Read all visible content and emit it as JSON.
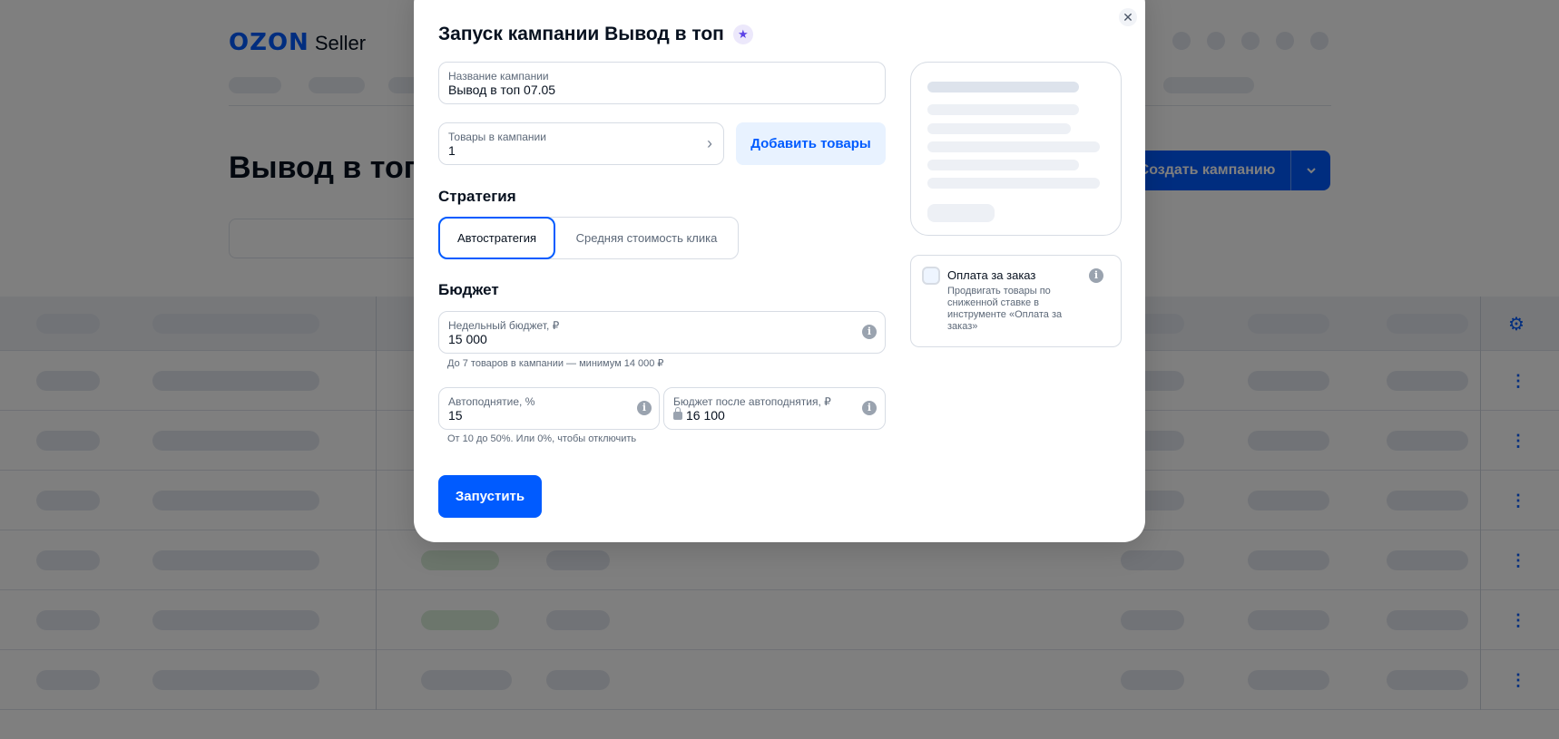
{
  "background": {
    "logo": {
      "brand": "OZON",
      "product": "Seller"
    },
    "page_title": "Вывод в топ",
    "create_button": {
      "label": "Создать кампанию"
    },
    "icons": {
      "settings": "gear-icon",
      "row_menu": "kebab-menu-icon",
      "dropdown": "chevron-down-icon"
    }
  },
  "modal": {
    "title": "Запуск кампании Вывод в топ",
    "campaign_name": {
      "label": "Название кампании",
      "value": "Вывод в топ 07.05"
    },
    "products": {
      "label": "Товары в кампании",
      "value": "1"
    },
    "add_products_button": "Добавить товары",
    "strategy": {
      "title": "Стратегия",
      "options": [
        "Автостратегия",
        "Средняя стоимость клика"
      ],
      "selected": "Автостратегия"
    },
    "budget": {
      "title": "Бюджет",
      "weekly": {
        "label": "Недельный бюджет, ₽",
        "value": "15 000"
      },
      "weekly_hint": "До 7 товаров в кампании — минимум 14 000 ₽",
      "auto_raise": {
        "label": "Автоподнятие, %",
        "value": "15"
      },
      "after_raise": {
        "label": "Бюджет после автоподнятия, ₽",
        "value": "16 100"
      },
      "auto_raise_hint": "От 10 до 50%. Или 0%, чтобы отключить"
    },
    "launch_button": "Запустить",
    "pay_per_order": {
      "title": "Оплата за заказ",
      "description": "Продвигать товары по сниженной ставке в инструменте «Оплата за заказ»",
      "checked": false
    },
    "icons": {
      "close": "close-icon",
      "star": "star-icon",
      "info": "info-icon",
      "chevron": "chevron-right-icon",
      "lock": "lock-icon"
    }
  }
}
